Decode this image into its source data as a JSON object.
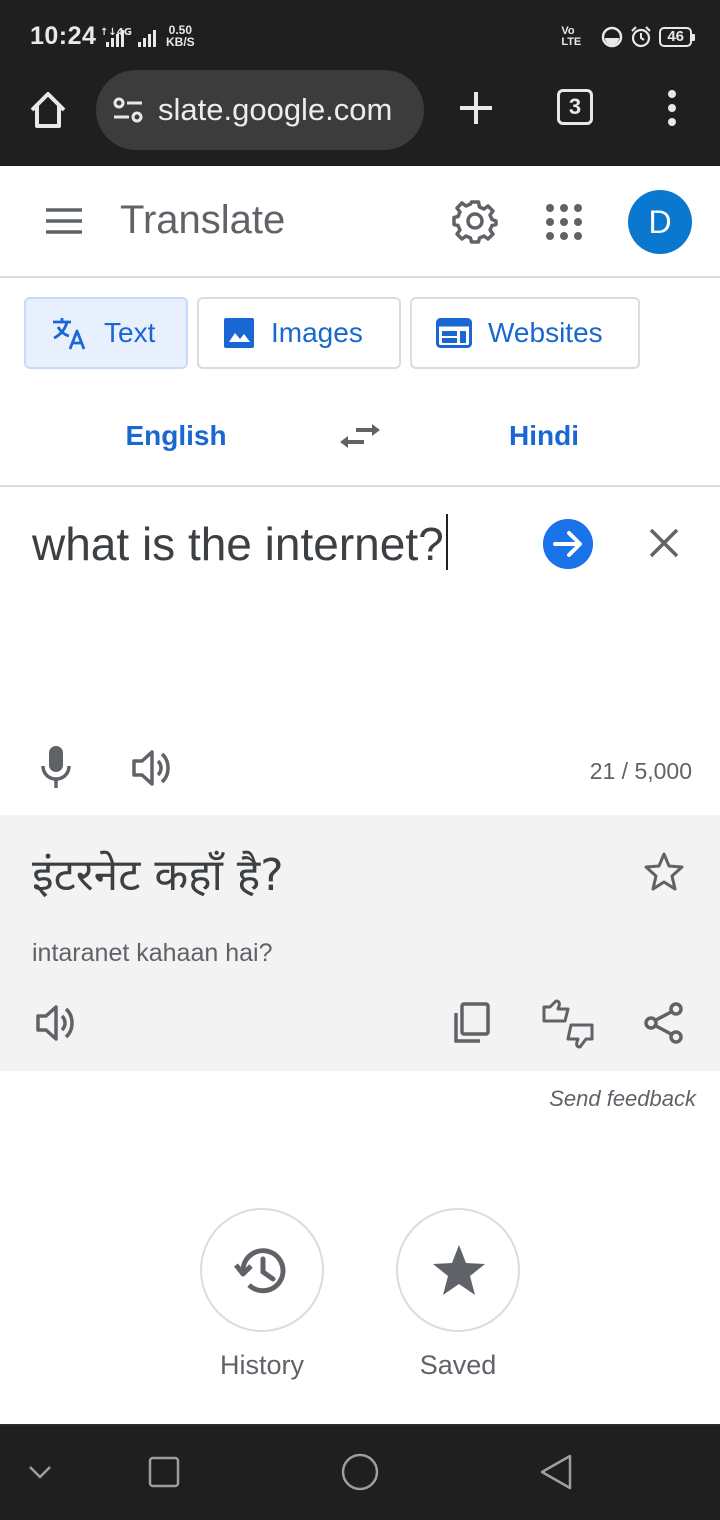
{
  "status_bar": {
    "time": "10:24",
    "network": "4G",
    "speed_value": "0.50",
    "speed_unit": "KB/S",
    "volte": "Vo LTE",
    "battery": "46"
  },
  "browser": {
    "url": "slate.google.com",
    "tab_count": "3"
  },
  "header": {
    "title": "Translate",
    "avatar_letter": "D"
  },
  "mode_tabs": [
    {
      "label": "Text",
      "active": true
    },
    {
      "label": "Images",
      "active": false
    },
    {
      "label": "Websites",
      "active": false
    }
  ],
  "languages": {
    "source": "English",
    "target": "Hindi"
  },
  "input": {
    "text": "what is the internet?",
    "char_count": "21 / 5,000"
  },
  "output": {
    "translation": "इंटरनेट कहाँ है?",
    "romanization": "intaranet kahaan hai?"
  },
  "feedback": {
    "label": "Send feedback"
  },
  "shortcuts": {
    "history": "History",
    "saved": "Saved"
  },
  "colors": {
    "accent": "#1a73e8",
    "link_blue": "#1967d2",
    "chrome_dark": "#1f1f1f",
    "output_bg": "#f3f3f3"
  }
}
